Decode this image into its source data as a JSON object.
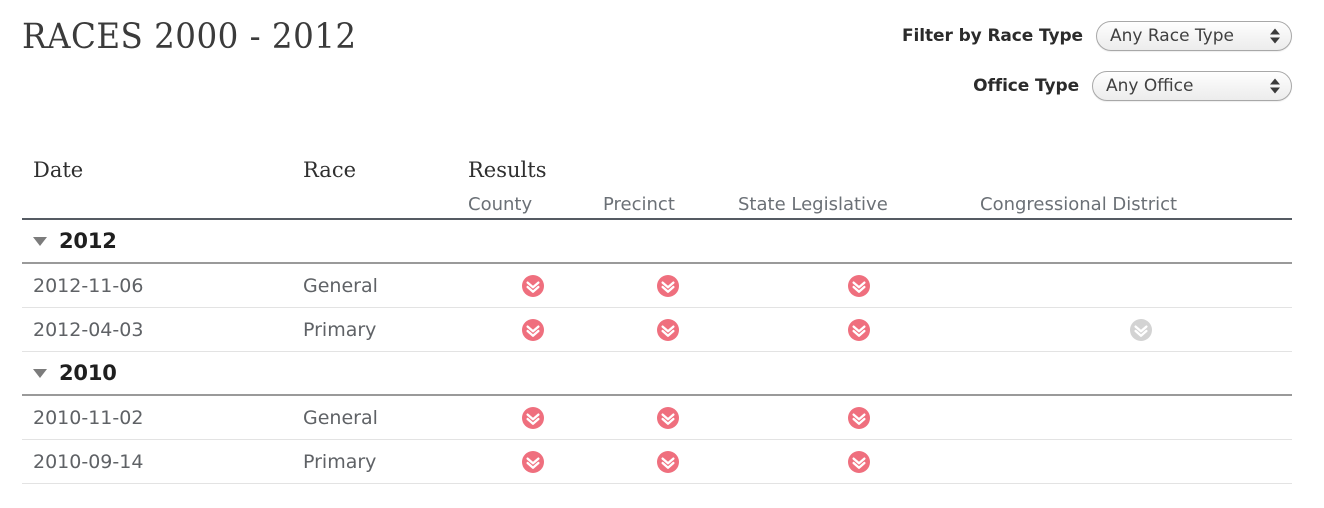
{
  "header": {
    "title": "RACES 2000 - 2012",
    "filters": [
      {
        "label": "Filter by Race Type",
        "name": "race-type",
        "value": "Any Race Type",
        "options": [
          "Any Race Type"
        ]
      },
      {
        "label": "Office Type",
        "name": "office-type",
        "value": "Any Office",
        "options": [
          "Any Office"
        ]
      }
    ]
  },
  "table": {
    "columns": {
      "date": "Date",
      "race": "Race",
      "results": "Results"
    },
    "result_columns": [
      {
        "key": "county",
        "label": "County"
      },
      {
        "key": "precinct",
        "label": "Precinct"
      },
      {
        "key": "state_legislative",
        "label": "State Legislative"
      },
      {
        "key": "congressional_district",
        "label": "Congressional District"
      }
    ],
    "groups": [
      {
        "year": "2012",
        "expanded": true,
        "caret_icon": "triangle-down-icon",
        "rows": [
          {
            "date": "2012-11-06",
            "race": "General",
            "county": "enabled",
            "precinct": "enabled",
            "state_legislative": "enabled",
            "congressional_district": "none"
          },
          {
            "date": "2012-04-03",
            "race": "Primary",
            "county": "enabled",
            "precinct": "enabled",
            "state_legislative": "enabled",
            "congressional_district": "disabled"
          }
        ]
      },
      {
        "year": "2010",
        "expanded": true,
        "caret_icon": "triangle-down-icon",
        "rows": [
          {
            "date": "2010-11-02",
            "race": "General",
            "county": "enabled",
            "precinct": "enabled",
            "state_legislative": "enabled",
            "congressional_district": "none"
          },
          {
            "date": "2010-09-14",
            "race": "Primary",
            "county": "enabled",
            "precinct": "enabled",
            "state_legislative": "enabled",
            "congressional_district": "none"
          }
        ]
      }
    ],
    "download_icon_name": "download-chevrons-icon"
  },
  "colors": {
    "accent": "#ef6f7e",
    "accent_disabled": "#d3d3d3",
    "title_text": "#3b3b3b",
    "body_text": "#5f6266",
    "subheader_text": "#6b7076",
    "header_rule": "#555b63",
    "group_rule": "#9a9a9a",
    "row_rule": "#e3e3e3",
    "background": "#ffffff"
  }
}
